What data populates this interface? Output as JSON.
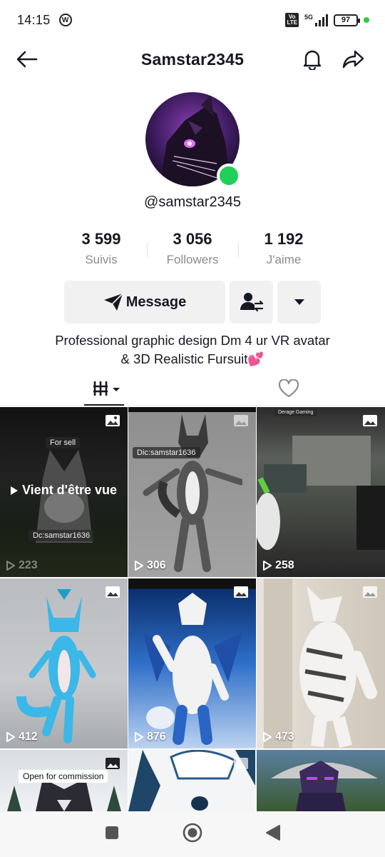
{
  "status_bar": {
    "time": "14:15",
    "network": "5G",
    "volte": "Vo LTE",
    "battery": "97"
  },
  "header": {
    "title": "Samstar2345"
  },
  "profile": {
    "username": "@samstar2345",
    "stats": [
      {
        "value": "3 599",
        "label": "Suivis"
      },
      {
        "value": "3 056",
        "label": "Followers"
      },
      {
        "value": "1 192",
        "label": "J'aime"
      }
    ],
    "message_label": "Message",
    "bio_line1": "Professional graphic design Dm 4 ur VR avatar",
    "bio_line2": "& 3D Realistic Fursuit💕"
  },
  "colors": {
    "online": "#20d05a",
    "text": "#161823",
    "muted": "#8a8b91",
    "button_bg": "#f1f1f2"
  },
  "grid": {
    "viewed_label": "Vient d'être vue",
    "tiles": [
      {
        "count": "223",
        "tag1": "For sell",
        "tag2": "Dc:samstar1636"
      },
      {
        "count": "306",
        "tag1": "Dic:samstar1636"
      },
      {
        "count": "258",
        "tag1": "Derage Gaming"
      },
      {
        "count": "412"
      },
      {
        "count": "876"
      },
      {
        "count": "473"
      },
      {
        "tag1": "Open for commission"
      },
      {},
      {}
    ]
  }
}
